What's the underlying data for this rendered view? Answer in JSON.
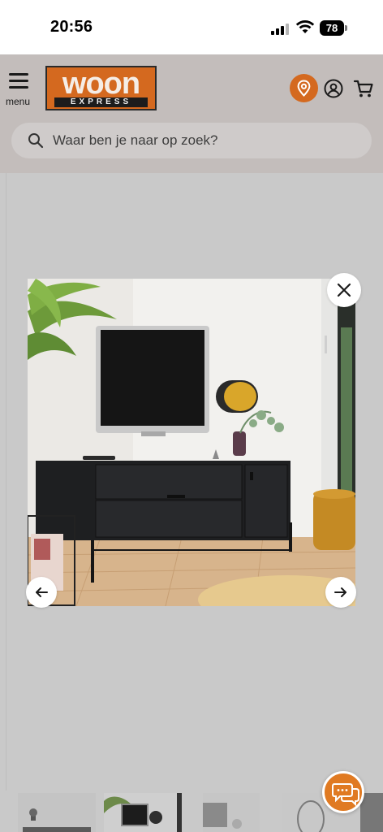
{
  "status_bar": {
    "time": "20:56",
    "battery": "78"
  },
  "header": {
    "menu_label": "menu",
    "logo_word": "woon",
    "logo_sub": "EXPRESS",
    "brand_color": "#d4691f"
  },
  "search": {
    "placeholder": "Waar ben je naar op zoek?"
  },
  "lightbox": {
    "icons": {
      "close": "close-icon",
      "previous": "arrow-left-icon",
      "next": "arrow-right-icon"
    }
  },
  "chat": {
    "icon": "chat-bubbles-icon"
  },
  "thumbnails": {
    "count_visible": 5
  }
}
